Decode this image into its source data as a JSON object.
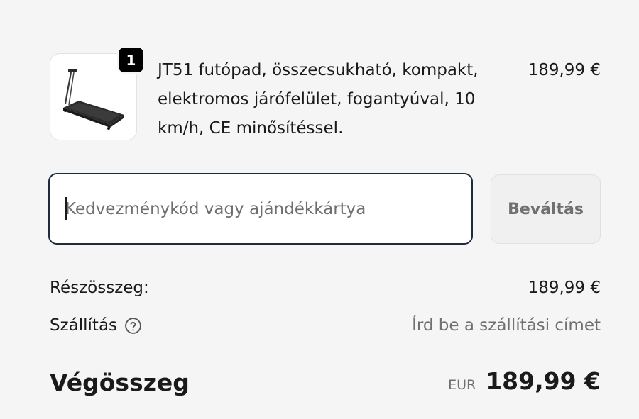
{
  "product": {
    "image_icon": "treadmill-image",
    "quantity": "1",
    "title": "JT51 futópad, összecsukható, kompakt, elektromos járófelület, fogantyúval, 10 km/h, CE minősítéssel.",
    "price": "189,99 €"
  },
  "discount": {
    "placeholder": "Kedvezménykód vagy ajándékkártya",
    "value": "",
    "button_label": "Beváltás"
  },
  "summary": {
    "subtotal_label": "Részösszeg:",
    "subtotal_value": "189,99 €",
    "shipping_label": "Szállítás",
    "shipping_icon": "question-circle-icon",
    "shipping_value": "Írd be a szállítási címet",
    "total_label": "Végösszeg",
    "currency_code": "EUR",
    "total_value": "189,99 €"
  },
  "colors": {
    "background": "#f5f5f5",
    "input_border": "#1e2b3d",
    "badge": "#000000",
    "muted_text": "#707070"
  }
}
